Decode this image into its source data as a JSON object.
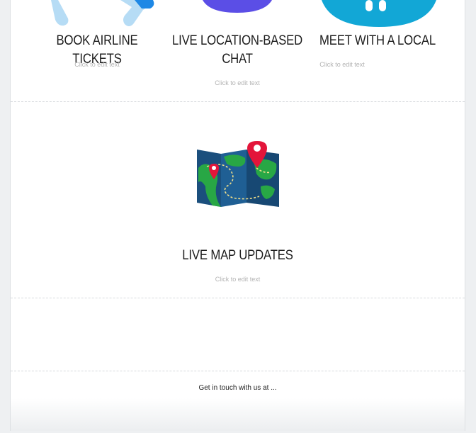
{
  "features": [
    {
      "title": "BOOK AIRLINE TICKETS",
      "edit_hint": "Click to edit text"
    },
    {
      "title_line1": "LIVE LOCATION-BASED",
      "title_line2": "CHAT",
      "edit_hint": "Click to edit text"
    },
    {
      "title": "MEET WITH A LOCAL",
      "edit_hint": "Click to edit text"
    }
  ],
  "map_feature": {
    "title": "LIVE MAP UPDATES",
    "edit_hint": "Click to edit text"
  },
  "footer": {
    "text": "Get in touch with us at ..."
  },
  "colors": {
    "ticket_icon": "#1e88e5",
    "chat_icon": "#5b4ee6",
    "local_icon": "#12a7d6",
    "pin": "#e3153a",
    "map_blue": "#1b4f7d",
    "map_green": "#28a745"
  }
}
